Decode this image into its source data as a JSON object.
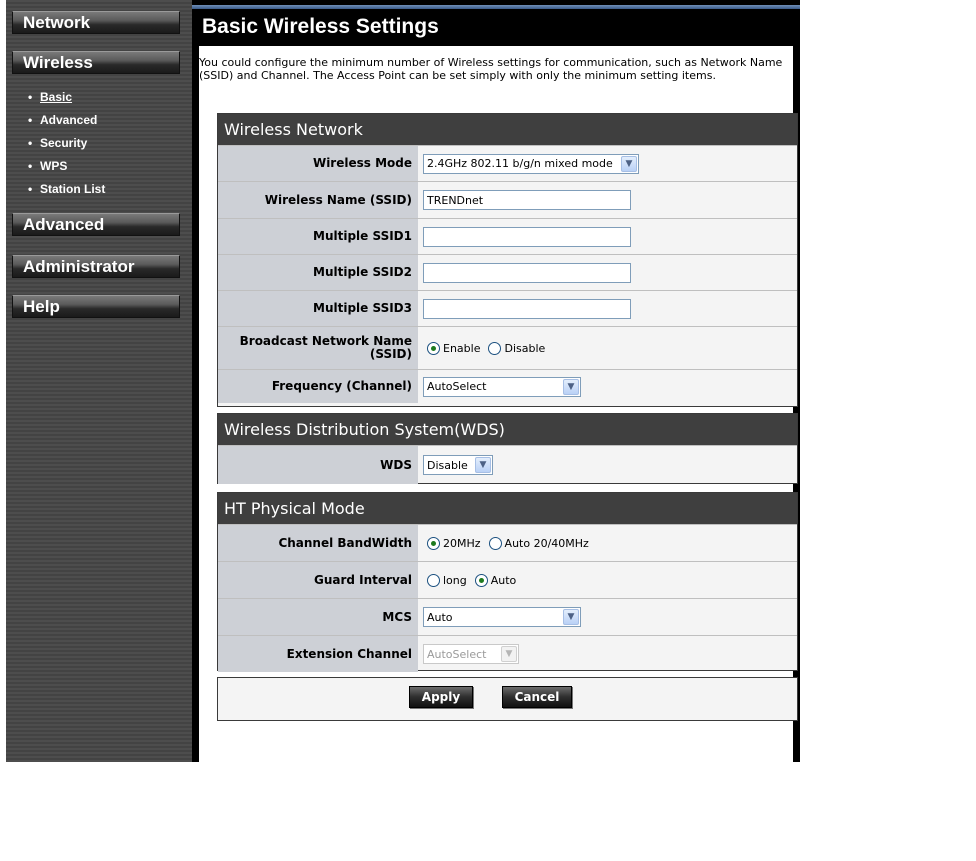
{
  "nav": {
    "network": "Network",
    "wireless": "Wireless",
    "advanced": "Advanced",
    "administrator": "Administrator",
    "help": "Help"
  },
  "submenu": [
    {
      "bullet": "•",
      "label": "Basic"
    },
    {
      "bullet": "•",
      "label": "Advanced"
    },
    {
      "bullet": "•",
      "label": "Security"
    },
    {
      "bullet": "•",
      "label": "WPS"
    },
    {
      "bullet": "•",
      "label": "Station List"
    }
  ],
  "page": {
    "title": "Basic Wireless Settings",
    "intro": "You could configure the minimum number of Wireless settings for communication, such as Network Name (SSID) and Channel. The Access Point can be set simply with only the minimum setting items."
  },
  "wireless_network": {
    "heading": "Wireless Network",
    "mode_label": "Wireless Mode",
    "mode_value": "2.4GHz 802.11 b/g/n mixed mode",
    "ssid_label": "Wireless Name (SSID)",
    "ssid_value": "TRENDnet",
    "ssid1_label": "Multiple SSID1",
    "ssid1_value": "",
    "ssid2_label": "Multiple SSID2",
    "ssid2_value": "",
    "ssid3_label": "Multiple SSID3",
    "ssid3_value": "",
    "broadcast_label": "Broadcast Network Name (SSID)",
    "broadcast_enable": "Enable",
    "broadcast_disable": "Disable",
    "frequency_label": "Frequency (Channel)",
    "frequency_value": "AutoSelect"
  },
  "wds": {
    "heading": "Wireless Distribution System(WDS)",
    "label": "WDS",
    "value": "Disable"
  },
  "ht": {
    "heading": "HT Physical Mode",
    "bandwidth_label": "Channel BandWidth",
    "bw_20": "20MHz",
    "bw_auto": "Auto 20/40MHz",
    "guard_label": "Guard Interval",
    "guard_long": "long",
    "guard_auto": "Auto",
    "mcs_label": "MCS",
    "mcs_value": "Auto",
    "ext_label": "Extension Channel",
    "ext_value": "AutoSelect"
  },
  "actions": {
    "apply": "Apply",
    "cancel": "Cancel"
  }
}
